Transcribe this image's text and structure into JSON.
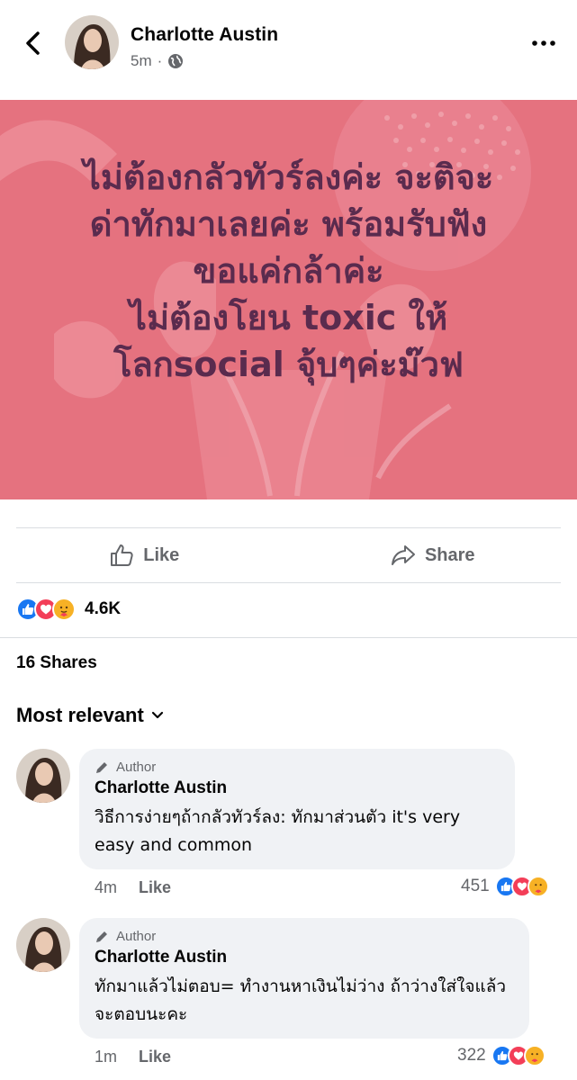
{
  "post": {
    "author": "Charlotte Austin",
    "time": "5m",
    "separator": "·",
    "text_lines": [
      "ไม่ต้องกลัวทัวร์ลงค่ะ จะติจะ",
      "ด่าทักมาเลยค่ะ พร้อมรับฟัง",
      "ขอแค่กล้าค่ะ",
      "ไม่ต้องโยน toxic ให้",
      "โลกsocial จุ้บๆค่ะม๊วฟ"
    ],
    "background_color": "#e5727f",
    "text_color": "#5a2b4e"
  },
  "actions": {
    "like_label": "Like",
    "share_label": "Share"
  },
  "reactions": {
    "count": "4.6K",
    "icons": [
      "like-reaction",
      "love-reaction",
      "care-reaction"
    ]
  },
  "shares_label": "16 Shares",
  "sort_label": "Most relevant",
  "comments": [
    {
      "badge": "Author",
      "name": "Charlotte Austin",
      "text": "วิธีการง่ายๆถ้ากลัวทัวร์ลง: ทักมาส่วนตัว it's very easy and common",
      "time": "4m",
      "like_label": "Like",
      "reaction_count": "451"
    },
    {
      "badge": "Author",
      "name": "Charlotte Austin",
      "text": "ทักมาแล้วไม่ตอบ= ทำงานหาเงินไม่ว่าง ถ้าว่างใส่ใจแล้วจะตอบนะคะ",
      "time": "1m",
      "like_label": "Like",
      "reaction_count": "322"
    }
  ],
  "colors": {
    "like_blue": "#1877f2",
    "love_red": "#f33e58",
    "care_yellow": "#f7b125",
    "secondary_text": "#65676b"
  }
}
